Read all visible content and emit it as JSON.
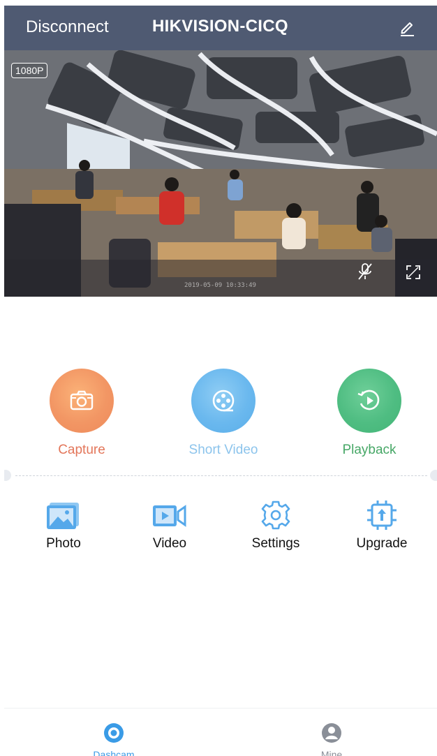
{
  "header": {
    "disconnect_label": "Disconnect",
    "device_name": "HIKVISION-CICQ",
    "edit_icon": "pencil-icon"
  },
  "video": {
    "resolution_badge": "1080P",
    "timestamp": "2019-05-09 10:33:49",
    "mute_icon": "microphone-muted-icon",
    "fullscreen_icon": "fullscreen-icon"
  },
  "actions": [
    {
      "label": "Capture",
      "icon": "camera-icon",
      "color": "#f29664"
    },
    {
      "label": "Short Video",
      "icon": "film-reel-icon",
      "color": "#6ab8ee"
    },
    {
      "label": "Playback",
      "icon": "playback-icon",
      "color": "#4fbd82"
    }
  ],
  "features": [
    {
      "label": "Photo",
      "icon": "image-icon"
    },
    {
      "label": "Video",
      "icon": "video-camera-icon"
    },
    {
      "label": "Settings",
      "icon": "gear-icon"
    },
    {
      "label": "Upgrade",
      "icon": "chip-upgrade-icon"
    }
  ],
  "bottom_nav": [
    {
      "label": "Dashcam",
      "icon": "dashcam-icon",
      "active": true
    },
    {
      "label": "Mine",
      "icon": "user-icon",
      "active": false
    }
  ],
  "colors": {
    "header_bg": "#4f5a72",
    "accent_blue": "#3a9be6",
    "icon_blue": "#55a8ea"
  }
}
